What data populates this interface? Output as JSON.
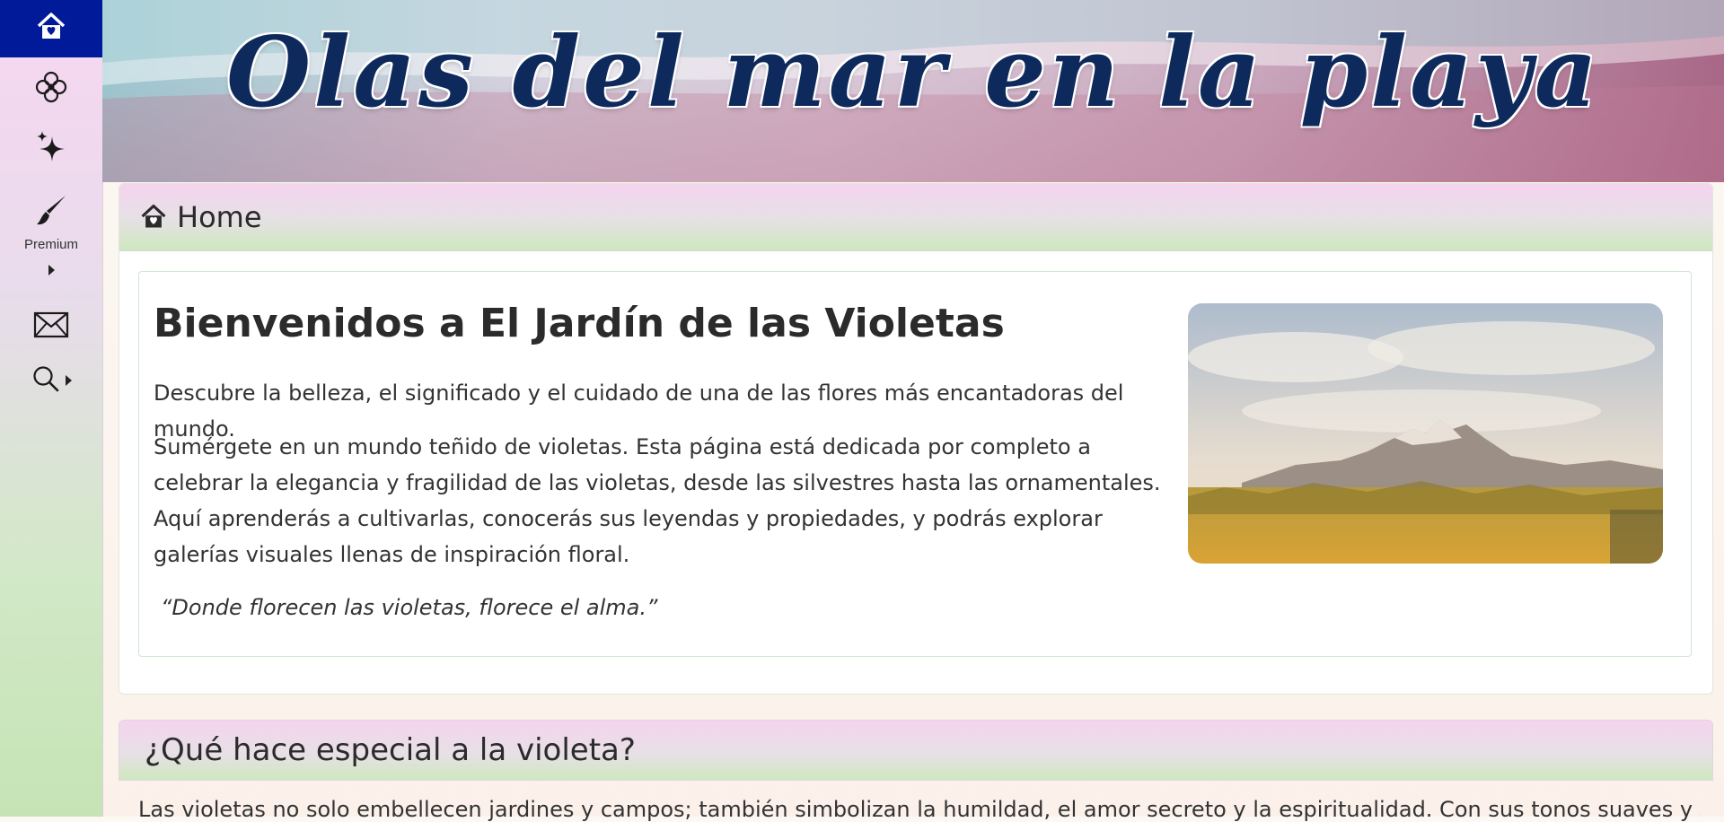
{
  "sidebar": {
    "items": [
      {
        "icon": "home-icon"
      },
      {
        "icon": "flower-icon"
      },
      {
        "icon": "sparkles-icon"
      },
      {
        "icon": "brush-icon",
        "label": "Premium"
      },
      {
        "icon": "envelope-icon"
      },
      {
        "icon": "search-icon"
      }
    ]
  },
  "banner": {
    "title": "Olas del mar en la playa"
  },
  "home_panel": {
    "header": "Home",
    "welcome_title": "Bienvenidos a El Jardín de las Violetas",
    "intro": "Descubre la belleza, el significado y el cuidado de una de las flores más encantadoras del mundo.",
    "body": "Sumérgete en un mundo teñido de violetas. Esta página está dedicada por completo a celebrar la elegancia y fragilidad de las violetas, desde las silvestres hasta las ornamentales. Aquí aprenderás a cultivarlas, conocerás sus leyendas y propiedades, y podrás explorar galerías visuales llenas de inspiración floral.",
    "quote": "“Donde florecen las violetas, florece el alma.”"
  },
  "special_section": {
    "title": "¿Qué hace especial a la violeta?",
    "body": "Las violetas no solo embellecen jardines y campos; también simbolizan la humildad, el amor secreto y la espiritualidad. Con sus tonos suaves y su"
  },
  "colors": {
    "home_active": "#001a9a",
    "banner_title": "#0e2a5c"
  }
}
